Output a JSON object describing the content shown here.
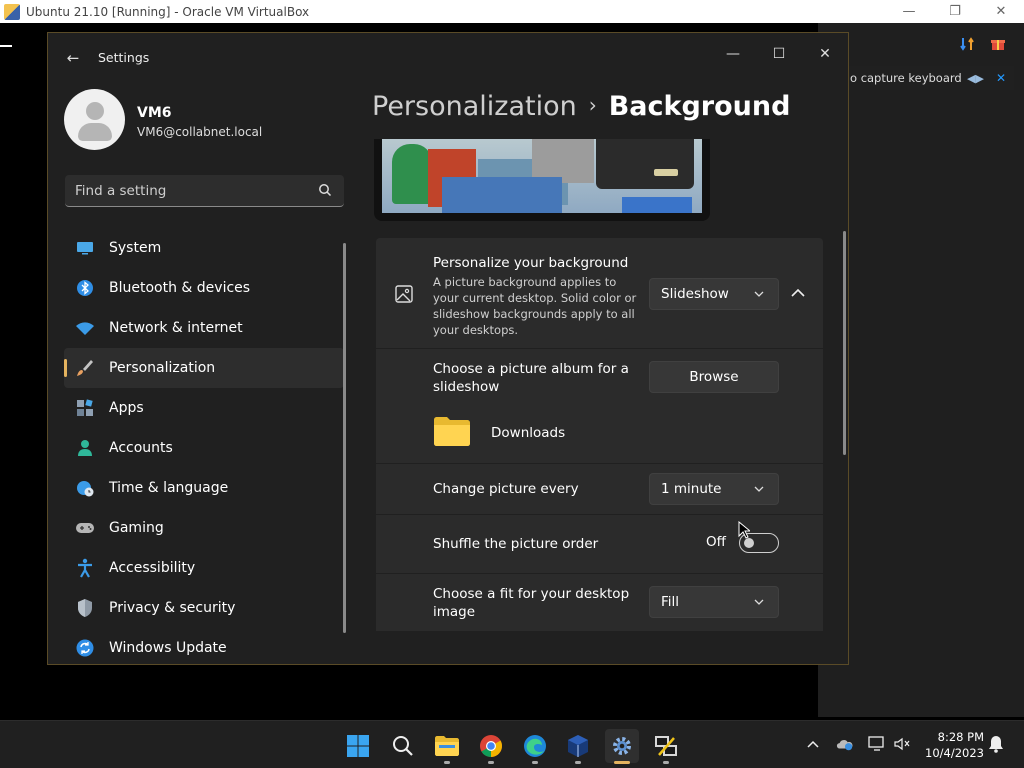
{
  "vbox": {
    "title": "Ubuntu 21.10 [Running] - Oracle VM VirtualBox",
    "minimize": "—",
    "restore": "❐",
    "close": "✕",
    "notice": "o capture keyboard ..."
  },
  "settings": {
    "app_name": "Settings",
    "back": "←",
    "minimize": "—",
    "maximize": "☐",
    "close": "✕",
    "user": {
      "name": "VM6",
      "email": "VM6@collabnet.local"
    },
    "search": {
      "placeholder": "Find a setting"
    },
    "nav": [
      {
        "label": "System",
        "icon": "monitor-icon",
        "color": "#4aa8e8"
      },
      {
        "label": "Bluetooth & devices",
        "icon": "bluetooth-icon",
        "color": "#2f8ee6"
      },
      {
        "label": "Network & internet",
        "icon": "wifi-icon",
        "color": "#3b9be8"
      },
      {
        "label": "Personalization",
        "icon": "paintbrush-icon",
        "color": "#e8a060",
        "active": true
      },
      {
        "label": "Apps",
        "icon": "apps-icon",
        "color": "#8fa0b3"
      },
      {
        "label": "Accounts",
        "icon": "person-icon",
        "color": "#2fb89a"
      },
      {
        "label": "Time & language",
        "icon": "globe-clock-icon",
        "color": "#3b9be8"
      },
      {
        "label": "Gaming",
        "icon": "gamepad-icon",
        "color": "#b5b5b5"
      },
      {
        "label": "Accessibility",
        "icon": "accessibility-icon",
        "color": "#3b9be8"
      },
      {
        "label": "Privacy & security",
        "icon": "shield-icon",
        "color": "#8f9aa6"
      },
      {
        "label": "Windows Update",
        "icon": "update-icon",
        "color": "#2f8ee6"
      }
    ],
    "breadcrumb": {
      "parent": "Personalization",
      "separator": "›",
      "current": "Background"
    },
    "background": {
      "personalize_title": "Personalize your background",
      "personalize_desc": "A picture background applies to your current desktop. Solid color or slideshow backgrounds apply to all your desktops.",
      "personalize_value": "Slideshow",
      "album_title": "Choose a picture album for a slideshow",
      "browse_label": "Browse",
      "folder_name": "Downloads",
      "interval_title": "Change picture every",
      "interval_value": "1 minute",
      "shuffle_title": "Shuffle the picture order",
      "shuffle_state": "Off",
      "fit_title": "Choose a fit for your desktop image",
      "fit_value": "Fill"
    }
  },
  "taskbar": {
    "apps": [
      {
        "name": "start",
        "icon": "windows-logo-icon"
      },
      {
        "name": "search",
        "icon": "search-icon"
      },
      {
        "name": "file-explorer",
        "icon": "folder-icon"
      },
      {
        "name": "chrome",
        "icon": "chrome-icon"
      },
      {
        "name": "edge",
        "icon": "edge-icon"
      },
      {
        "name": "virtualbox",
        "icon": "virtualbox-icon"
      },
      {
        "name": "settings",
        "icon": "gear-icon",
        "active": true
      },
      {
        "name": "putty",
        "icon": "terminal-icon"
      }
    ],
    "time": "8:28 PM",
    "date": "10/4/2023"
  },
  "colors": {
    "accent": "#e4b35f",
    "window_bg": "#202020",
    "card_bg": "#2b2b2b"
  }
}
